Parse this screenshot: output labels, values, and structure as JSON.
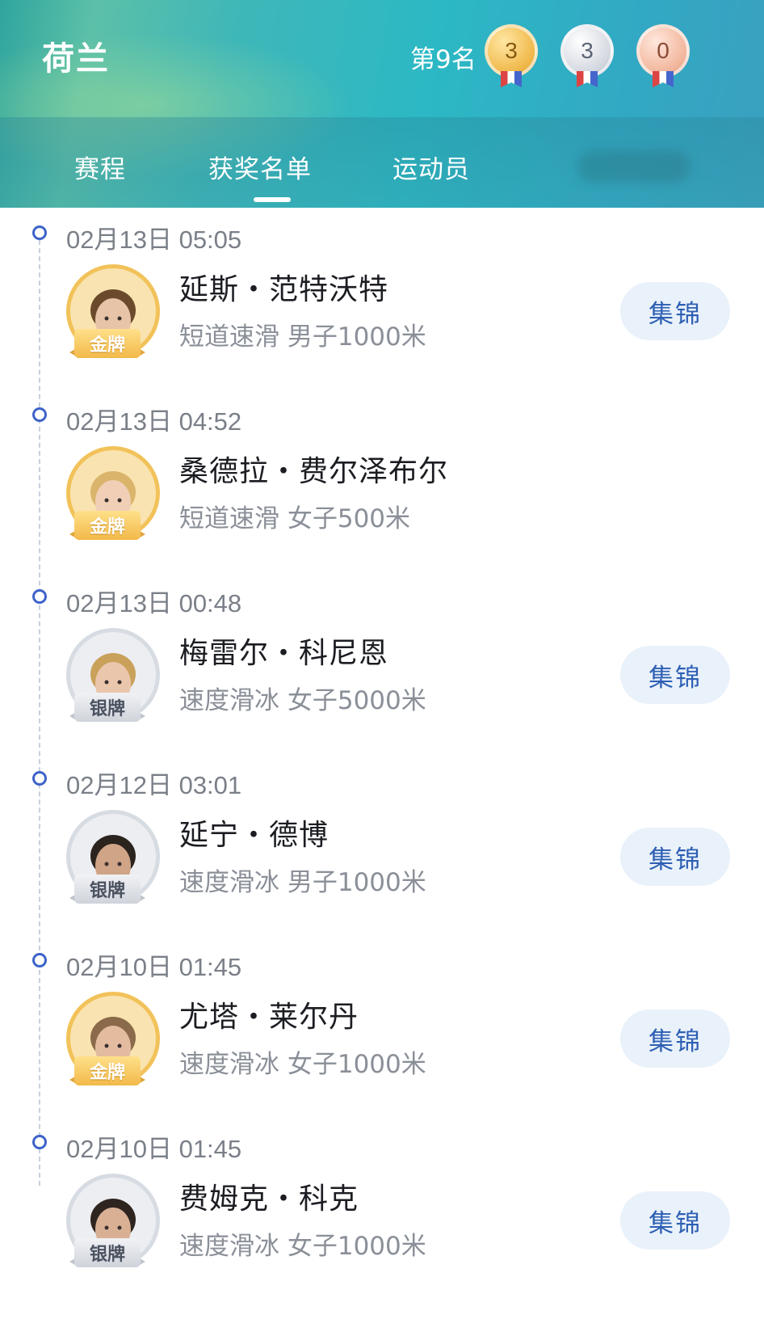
{
  "header": {
    "country": "荷兰",
    "rank": "第9名",
    "medals": {
      "gold": "3",
      "silver": "3",
      "bronze": "0"
    }
  },
  "tabs": [
    {
      "label": "赛程",
      "active": false
    },
    {
      "label": "获奖名单",
      "active": true
    },
    {
      "label": "运动员",
      "active": false
    }
  ],
  "entries": [
    {
      "time": "02月13日 05:05",
      "name": "延斯・范特沃特",
      "event": "短道速滑 男子1000米",
      "medal": "金牌",
      "medal_type": "gold",
      "highlight": "集锦"
    },
    {
      "time": "02月13日 04:52",
      "name": "桑德拉・费尔泽布尔",
      "event": "短道速滑 女子500米",
      "medal": "金牌",
      "medal_type": "gold",
      "highlight": ""
    },
    {
      "time": "02月13日 00:48",
      "name": "梅雷尔・科尼恩",
      "event": "速度滑冰 女子5000米",
      "medal": "银牌",
      "medal_type": "silver",
      "highlight": "集锦"
    },
    {
      "time": "02月12日 03:01",
      "name": "延宁・德博",
      "event": "速度滑冰 男子1000米",
      "medal": "银牌",
      "medal_type": "silver",
      "highlight": "集锦"
    },
    {
      "time": "02月10日 01:45",
      "name": "尤塔・莱尔丹",
      "event": "速度滑冰 女子1000米",
      "medal": "金牌",
      "medal_type": "gold",
      "highlight": "集锦"
    },
    {
      "time": "02月10日 01:45",
      "name": "费姆克・科克",
      "event": "速度滑冰 女子1000米",
      "medal": "银牌",
      "medal_type": "silver",
      "highlight": "集锦"
    }
  ]
}
